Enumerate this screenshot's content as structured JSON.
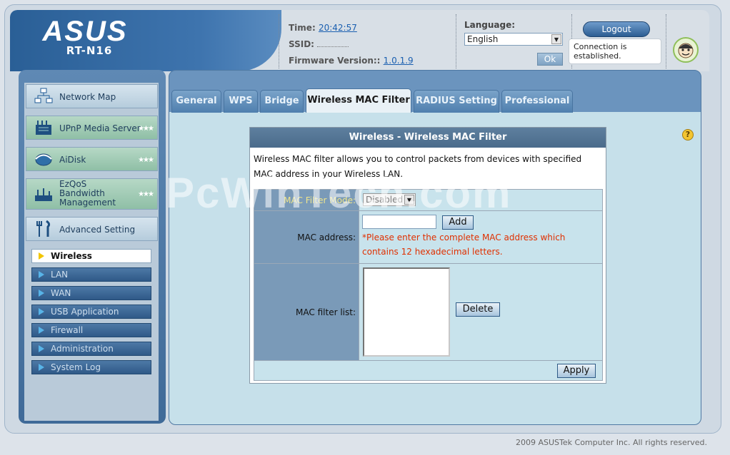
{
  "header": {
    "brand": "ASUS",
    "model": "RT-N16",
    "time_label": "Time:",
    "time_value": "20:42:57",
    "ssid_label": "SSID:",
    "ssid_value": "",
    "firmware_label": "Firmware Version::",
    "firmware_value": "1.0.1.9",
    "language_label": "Language:",
    "language_selected": "English",
    "ok_label": "Ok",
    "logout_label": "Logout",
    "connection_status": "Connection is established."
  },
  "sidebar": {
    "main_items": [
      {
        "label": "Network Map",
        "icon": "network-map-icon"
      },
      {
        "label": "UPnP Media Server",
        "icon": "media-server-icon"
      },
      {
        "label": "AiDisk",
        "icon": "disk-icon"
      },
      {
        "label": "EzQoS Bandwidth Management",
        "icon": "qos-icon"
      },
      {
        "label": "Advanced Setting",
        "icon": "tools-icon"
      }
    ],
    "sub_items": [
      {
        "label": "Wireless",
        "active": true
      },
      {
        "label": "LAN",
        "active": false
      },
      {
        "label": "WAN",
        "active": false
      },
      {
        "label": "USB Application",
        "active": false
      },
      {
        "label": "Firewall",
        "active": false
      },
      {
        "label": "Administration",
        "active": false
      },
      {
        "label": "System Log",
        "active": false
      }
    ]
  },
  "tabs": [
    {
      "label": "General",
      "active": false
    },
    {
      "label": "WPS",
      "active": false
    },
    {
      "label": "Bridge",
      "active": false
    },
    {
      "label": "Wireless MAC Filter",
      "active": true
    },
    {
      "label": "RADIUS Setting",
      "active": false
    },
    {
      "label": "Professional",
      "active": false
    }
  ],
  "panel": {
    "title": "Wireless - Wireless MAC Filter",
    "description": "Wireless MAC filter allows you to control packets from devices with specified MAC address in your Wireless LAN.",
    "filter_mode_label": "MAC Filter Mode:",
    "filter_mode_value": "Disabled",
    "mac_address_label": "MAC address:",
    "add_label": "Add",
    "warning": "*Please enter the complete MAC address which contains 12 hexadecimal letters.",
    "mac_list_label": "MAC filter list:",
    "delete_label": "Delete",
    "apply_label": "Apply"
  },
  "footer": "2009 ASUSTek Computer Inc. All rights reserved.",
  "watermark": "PcWinTech.com",
  "help_symbol": "?"
}
